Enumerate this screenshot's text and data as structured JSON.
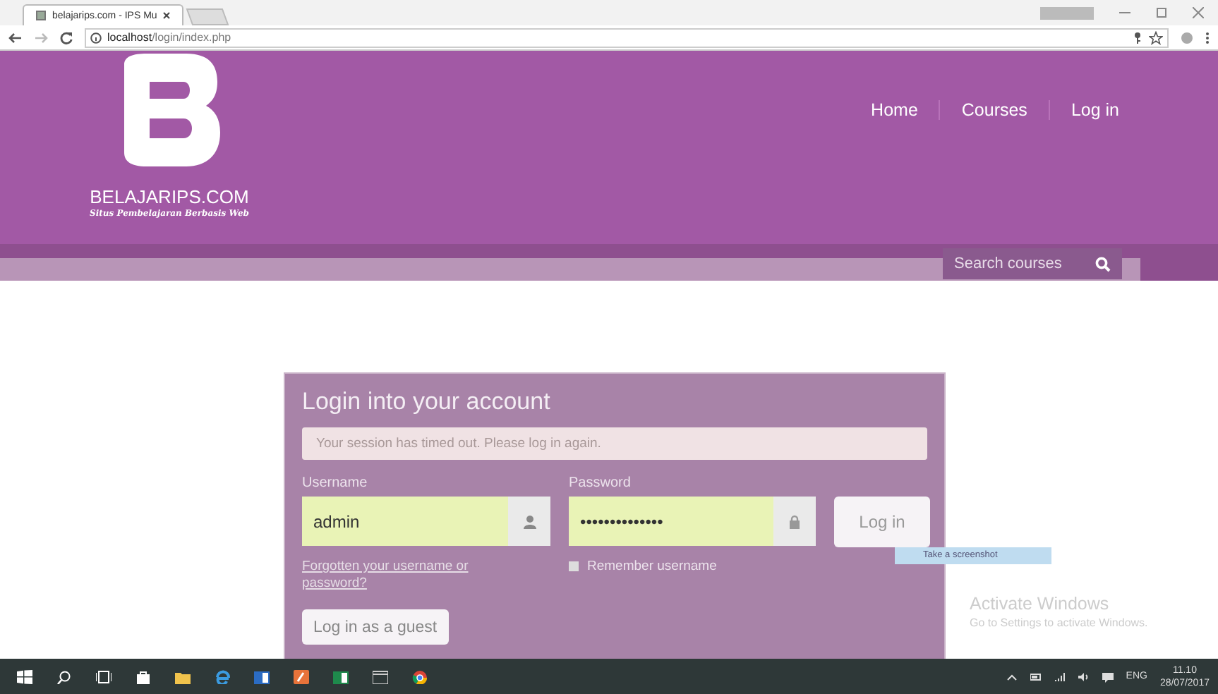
{
  "browser": {
    "tabs": [
      {
        "label": "belajarips.com - IPS Mu",
        "selected": true
      }
    ],
    "url_host": "localhost",
    "url_path": "/login/index.php"
  },
  "header": {
    "brand": "BELAJARIPS.COM",
    "tagline": "Situs Pembelajaran Berbasis Web",
    "nav": [
      "Home",
      "Courses",
      "Log in"
    ],
    "search": {
      "placeholder": "Search courses"
    }
  },
  "login": {
    "title": "Login into your account",
    "alert": "Your session has timed out. Please log in again.",
    "username": {
      "label": "Username",
      "value": "admin"
    },
    "password": {
      "label": "Password",
      "value": "••••••••••••••"
    },
    "login_button": "Log in",
    "forgot_link": "Forgotten your username or password?",
    "remember": {
      "label": "Remember username",
      "checked": false
    },
    "guest_button": "Log in as a guest"
  },
  "tooltip": "Take a screenshot",
  "activation": {
    "title": "Activate Windows",
    "message": "Go to Settings to activate Windows."
  },
  "taskbar": {
    "language": "ENG",
    "time": "11.10",
    "date": "28/07/2017"
  }
}
